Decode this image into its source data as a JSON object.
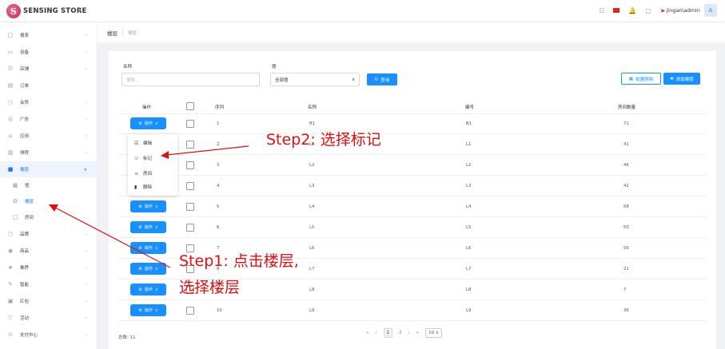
{
  "app": {
    "logo_letter": "S",
    "logo_text": "SENSING STORE",
    "collapse_icon": "chevron-left-icon",
    "user_name": "jingan\\admin",
    "avatar_letter": "A",
    "brand_color": "#1890ff"
  },
  "breadcrumb": {
    "current": "楼层",
    "sub": "楼层"
  },
  "sidebar": {
    "items": [
      {
        "label": "报表",
        "icon": "chart-icon"
      },
      {
        "label": "设备",
        "icon": "monitor-icon"
      },
      {
        "label": "店铺",
        "icon": "store-icon"
      },
      {
        "label": "订单",
        "icon": "clipboard-icon"
      },
      {
        "label": "会员",
        "icon": "member-icon"
      },
      {
        "label": "广告",
        "icon": "ad-icon"
      },
      {
        "label": "应用",
        "icon": "app-icon"
      },
      {
        "label": "排程",
        "icon": "schedule-icon"
      },
      {
        "label": "楼层",
        "icon": "building-icon"
      },
      {
        "label": "馆",
        "icon": "grid-icon"
      },
      {
        "label": "楼层",
        "icon": "floor-icon"
      },
      {
        "label": "房间",
        "icon": "room-icon"
      },
      {
        "label": "品牌",
        "icon": "brand-icon"
      },
      {
        "label": "商品",
        "icon": "goods-icon"
      },
      {
        "label": "推荐",
        "icon": "star-icon"
      },
      {
        "label": "智能",
        "icon": "brush-icon"
      },
      {
        "label": "红包",
        "icon": "redpacket-icon"
      },
      {
        "label": "活动",
        "icon": "activity-icon"
      },
      {
        "label": "支付中心",
        "icon": "pay-icon"
      }
    ]
  },
  "filters": {
    "name_label": "名称",
    "name_placeholder": "搜索...",
    "hall_label": "馆",
    "hall_value": "全部馆",
    "query_label": "查询",
    "batch_delete_label": "批量删除",
    "add_label": "添加楼层"
  },
  "table": {
    "headers": [
      "操作",
      "",
      "序列",
      "名称",
      "编号",
      "房间数量"
    ],
    "op_label": "操作",
    "rows": [
      {
        "seq": "1",
        "name": "B1",
        "code": "B1",
        "rooms": "71"
      },
      {
        "seq": "2",
        "name": "L1",
        "code": "L1",
        "rooms": "41"
      },
      {
        "seq": "3",
        "name": "L2",
        "code": "L2",
        "rooms": "46"
      },
      {
        "seq": "4",
        "name": "L3",
        "code": "L3",
        "rooms": "42"
      },
      {
        "seq": "5",
        "name": "L4",
        "code": "L4",
        "rooms": "58"
      },
      {
        "seq": "6",
        "name": "L5",
        "code": "L5",
        "rooms": "50"
      },
      {
        "seq": "7",
        "name": "L6",
        "code": "L6",
        "rooms": "56"
      },
      {
        "seq": "8",
        "name": "L7",
        "code": "L7",
        "rooms": "21"
      },
      {
        "seq": "9",
        "name": "L8",
        "code": "L8",
        "rooms": "7"
      },
      {
        "seq": "10",
        "name": "L9",
        "code": "L9",
        "rooms": "36"
      }
    ]
  },
  "dropdown": {
    "items": [
      {
        "label": "编辑",
        "icon": "edit-icon"
      },
      {
        "label": "标记",
        "icon": "mark-icon"
      },
      {
        "label": "房间",
        "icon": "room-icon"
      },
      {
        "label": "删除",
        "icon": "delete-icon"
      }
    ]
  },
  "footer": {
    "total": "总数: 11",
    "first": "«",
    "prev": "‹",
    "page1": "1",
    "page2": "2",
    "next": "›",
    "last": "»",
    "page_size": "10"
  },
  "annotations": {
    "step2": "Step2: 选择标记",
    "step1_line1": "Step1: 点击楼层,",
    "step1_line2": "选择楼层",
    "color": "#e01010"
  }
}
